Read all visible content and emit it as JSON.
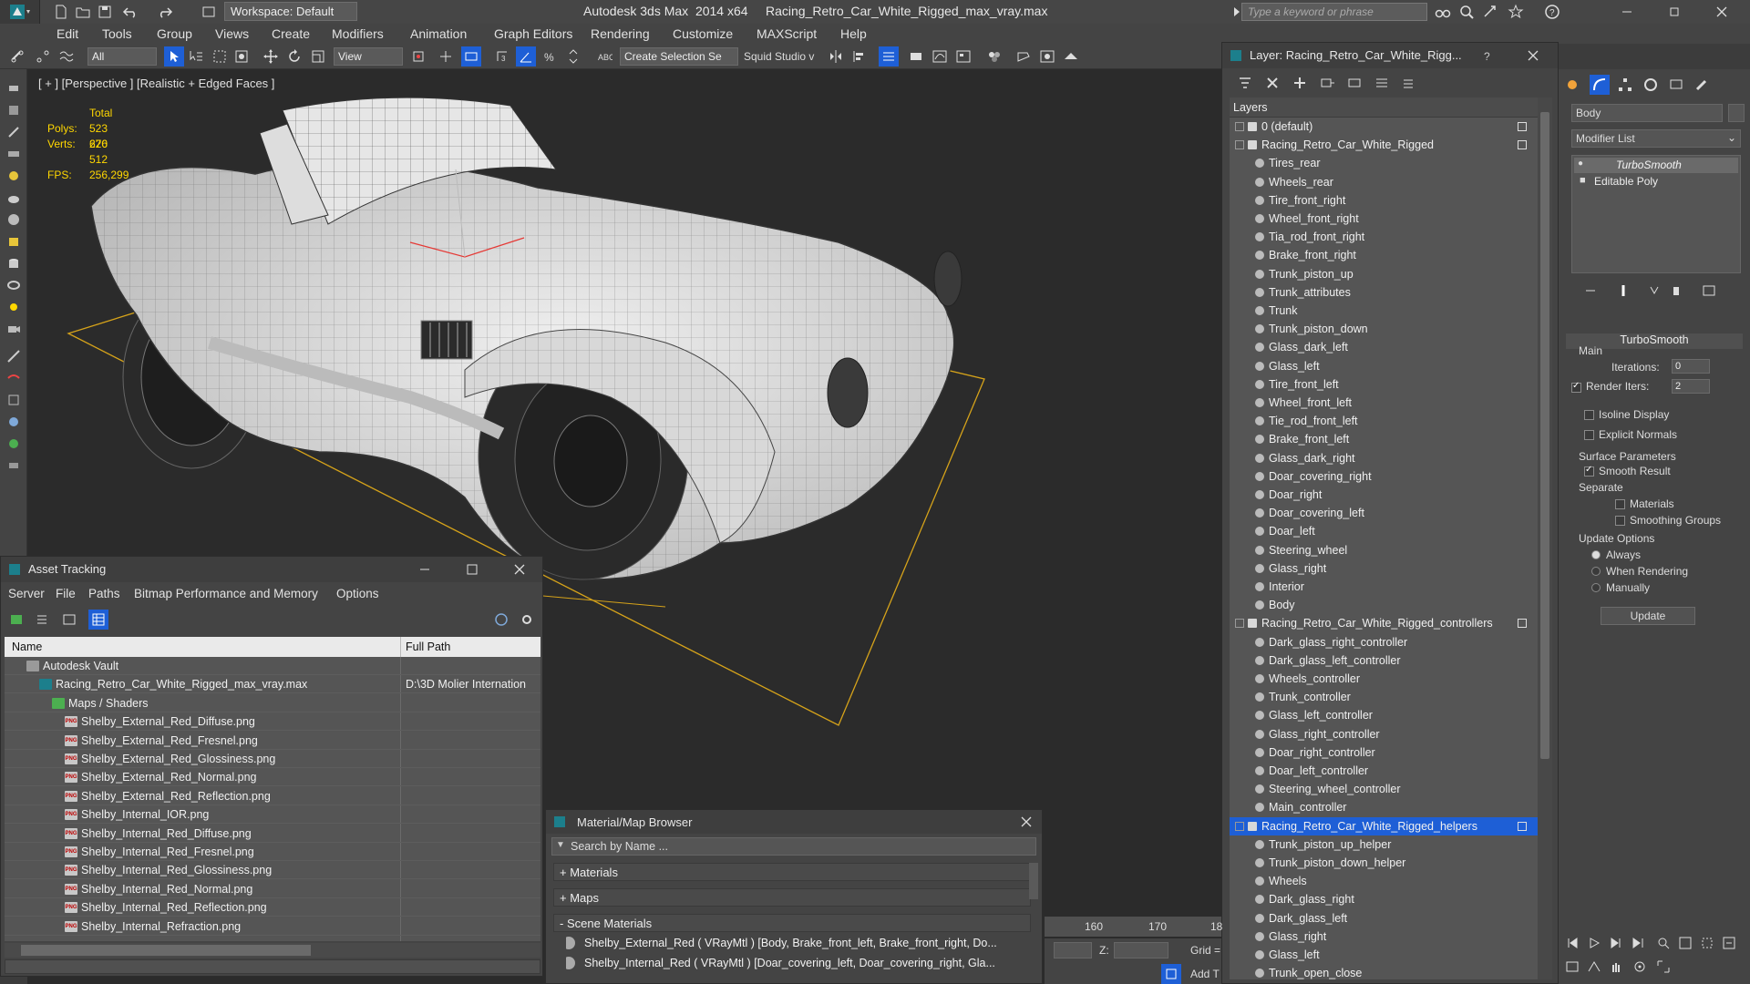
{
  "titlebar": {
    "workspace": "Workspace: Default",
    "title": "Autodesk 3ds Max  2014 x64     Racing_Retro_Car_White_Rigged_max_vray.max",
    "search_placeholder": "Type a keyword or phrase"
  },
  "menu": [
    "Edit",
    "Tools",
    "Group",
    "Views",
    "Create",
    "Modifiers",
    "Animation",
    "Graph Editors",
    "Rendering",
    "Customize",
    "MAXScript",
    "Help"
  ],
  "toolbar": {
    "filter": "All",
    "ref_coord": "View",
    "selection_set": "Create Selection Se",
    "squid": "Squid Studio v"
  },
  "viewport": {
    "label": "[ + ] [Perspective ] [Realistic + Edged Faces ]",
    "stats_total": "Total",
    "polys_label": "Polys:",
    "polys": "523 626",
    "verts_label": "Verts:",
    "verts": "270 512",
    "fps_label": "FPS:",
    "fps": "256,299"
  },
  "layers": {
    "title": "Layer: Racing_Retro_Car_White_Rigg...",
    "header": "Layers",
    "rows": [
      {
        "label": "0 (default)",
        "level": 0,
        "type": "layer"
      },
      {
        "label": "Racing_Retro_Car_White_Rigged",
        "level": 0,
        "type": "layer-open"
      },
      {
        "label": "Tires_rear",
        "level": 1,
        "type": "obj"
      },
      {
        "label": "Wheels_rear",
        "level": 1,
        "type": "obj"
      },
      {
        "label": "Tire_front_right",
        "level": 1,
        "type": "obj"
      },
      {
        "label": "Wheel_front_right",
        "level": 1,
        "type": "obj"
      },
      {
        "label": "Tia_rod_front_right",
        "level": 1,
        "type": "obj"
      },
      {
        "label": "Brake_front_right",
        "level": 1,
        "type": "obj"
      },
      {
        "label": "Trunk_piston_up",
        "level": 1,
        "type": "obj"
      },
      {
        "label": "Trunk_attributes",
        "level": 1,
        "type": "obj"
      },
      {
        "label": "Trunk",
        "level": 1,
        "type": "obj"
      },
      {
        "label": "Trunk_piston_down",
        "level": 1,
        "type": "obj"
      },
      {
        "label": "Glass_dark_left",
        "level": 1,
        "type": "obj"
      },
      {
        "label": "Glass_left",
        "level": 1,
        "type": "obj"
      },
      {
        "label": "Tire_front_left",
        "level": 1,
        "type": "obj"
      },
      {
        "label": "Wheel_front_left",
        "level": 1,
        "type": "obj"
      },
      {
        "label": "Tie_rod_front_left",
        "level": 1,
        "type": "obj"
      },
      {
        "label": "Brake_front_left",
        "level": 1,
        "type": "obj"
      },
      {
        "label": "Glass_dark_right",
        "level": 1,
        "type": "obj"
      },
      {
        "label": "Doar_covering_right",
        "level": 1,
        "type": "obj"
      },
      {
        "label": "Doar_right",
        "level": 1,
        "type": "obj"
      },
      {
        "label": "Doar_covering_left",
        "level": 1,
        "type": "obj"
      },
      {
        "label": "Doar_left",
        "level": 1,
        "type": "obj"
      },
      {
        "label": "Steering_wheel",
        "level": 1,
        "type": "obj"
      },
      {
        "label": "Glass_right",
        "level": 1,
        "type": "obj"
      },
      {
        "label": "Interior",
        "level": 1,
        "type": "obj"
      },
      {
        "label": "Body",
        "level": 1,
        "type": "obj"
      },
      {
        "label": "Racing_Retro_Car_White_Rigged_controllers",
        "level": 0,
        "type": "layer-open"
      },
      {
        "label": "Dark_glass_right_controller",
        "level": 1,
        "type": "obj"
      },
      {
        "label": "Dark_glass_left_controller",
        "level": 1,
        "type": "obj"
      },
      {
        "label": "Wheels_controller",
        "level": 1,
        "type": "obj"
      },
      {
        "label": "Trunk_controller",
        "level": 1,
        "type": "obj"
      },
      {
        "label": "Glass_left_controller",
        "level": 1,
        "type": "obj"
      },
      {
        "label": "Glass_right_controller",
        "level": 1,
        "type": "obj"
      },
      {
        "label": "Doar_right_controller",
        "level": 1,
        "type": "obj"
      },
      {
        "label": "Doar_left_controller",
        "level": 1,
        "type": "obj"
      },
      {
        "label": "Steering_wheel_controller",
        "level": 1,
        "type": "obj"
      },
      {
        "label": "Main_controller",
        "level": 1,
        "type": "obj"
      },
      {
        "label": "Racing_Retro_Car_White_Rigged_helpers",
        "level": 0,
        "type": "layer-open",
        "selected": true
      },
      {
        "label": "Trunk_piston_up_helper",
        "level": 1,
        "type": "obj"
      },
      {
        "label": "Trunk_piston_down_helper",
        "level": 1,
        "type": "obj"
      },
      {
        "label": "Wheels",
        "level": 1,
        "type": "obj"
      },
      {
        "label": "Dark_glass_right",
        "level": 1,
        "type": "obj"
      },
      {
        "label": "Dark_glass_left",
        "level": 1,
        "type": "obj"
      },
      {
        "label": "Glass_right",
        "level": 1,
        "type": "obj"
      },
      {
        "label": "Glass_left",
        "level": 1,
        "type": "obj"
      },
      {
        "label": "Trunk_open_close",
        "level": 1,
        "type": "obj"
      }
    ]
  },
  "command_panel": {
    "object_name": "Body",
    "modifier_list": "Modifier List",
    "stack": [
      "TurboSmooth",
      "Editable Poly"
    ],
    "turbosmooth_title": "TurboSmooth",
    "main_label": "Main",
    "iterations_label": "Iterations:",
    "iterations": "0",
    "render_iters_label": "Render Iters:",
    "render_iters": "2",
    "isoline": "Isoline Display",
    "explicit_normals": "Explicit Normals",
    "surface_params": "Surface Parameters",
    "smooth_result": "Smooth Result",
    "separate": "Separate",
    "materials": "Materials",
    "smoothing_groups": "Smoothing Groups",
    "update_options": "Update Options",
    "always": "Always",
    "when_rendering": "When Rendering",
    "manually": "Manually",
    "update_btn": "Update"
  },
  "asset_tracking": {
    "title": "Asset Tracking",
    "menu": [
      "Server",
      "File",
      "Paths",
      "Bitmap Performance and Memory",
      "Options"
    ],
    "col_name": "Name",
    "col_path": "Full Path",
    "rows": [
      {
        "label": "Autodesk Vault",
        "indent": 1,
        "icon": "vault",
        "path": ""
      },
      {
        "label": "Racing_Retro_Car_White_Rigged_max_vray.max",
        "indent": 2,
        "icon": "max",
        "path": "D:\\3D Molier Internation"
      },
      {
        "label": "Maps / Shaders",
        "indent": 3,
        "icon": "folder",
        "path": ""
      },
      {
        "label": "Shelby_External_Red_Diffuse.png",
        "indent": 4,
        "icon": "png",
        "path": ""
      },
      {
        "label": "Shelby_External_Red_Fresnel.png",
        "indent": 4,
        "icon": "png",
        "path": ""
      },
      {
        "label": "Shelby_External_Red_Glossiness.png",
        "indent": 4,
        "icon": "png",
        "path": ""
      },
      {
        "label": "Shelby_External_Red_Normal.png",
        "indent": 4,
        "icon": "png",
        "path": ""
      },
      {
        "label": "Shelby_External_Red_Reflection.png",
        "indent": 4,
        "icon": "png",
        "path": ""
      },
      {
        "label": "Shelby_Internal_IOR.png",
        "indent": 4,
        "icon": "png",
        "path": ""
      },
      {
        "label": "Shelby_Internal_Red_Diffuse.png",
        "indent": 4,
        "icon": "png",
        "path": ""
      },
      {
        "label": "Shelby_Internal_Red_Fresnel.png",
        "indent": 4,
        "icon": "png",
        "path": ""
      },
      {
        "label": "Shelby_Internal_Red_Glossiness.png",
        "indent": 4,
        "icon": "png",
        "path": ""
      },
      {
        "label": "Shelby_Internal_Red_Normal.png",
        "indent": 4,
        "icon": "png",
        "path": ""
      },
      {
        "label": "Shelby_Internal_Red_Reflection.png",
        "indent": 4,
        "icon": "png",
        "path": ""
      },
      {
        "label": "Shelby_Internal_Refraction.png",
        "indent": 4,
        "icon": "png",
        "path": ""
      }
    ]
  },
  "material_browser": {
    "title": "Material/Map Browser",
    "search_placeholder": "Search by Name ...",
    "sections": [
      "+ Materials",
      "+ Maps",
      "- Scene Materials"
    ],
    "scene_materials": [
      "Shelby_External_Red  ( VRayMtl )  [Body, Brake_front_left, Brake_front_right, Do...",
      "Shelby_Internal_Red  ( VRayMtl )  [Doar_covering_left, Doar_covering_right, Gla..."
    ]
  },
  "status": {
    "timeline_ticks": [
      "160",
      "170",
      "18"
    ],
    "z_label": "Z:",
    "grid_label": "Grid =",
    "add_t": "Add T"
  },
  "colors": {
    "selection": "#1e5fd6",
    "viewport_bg": "#2b2b2b",
    "stats_text": "#ffd700",
    "grid_line": "#d6a31a"
  }
}
